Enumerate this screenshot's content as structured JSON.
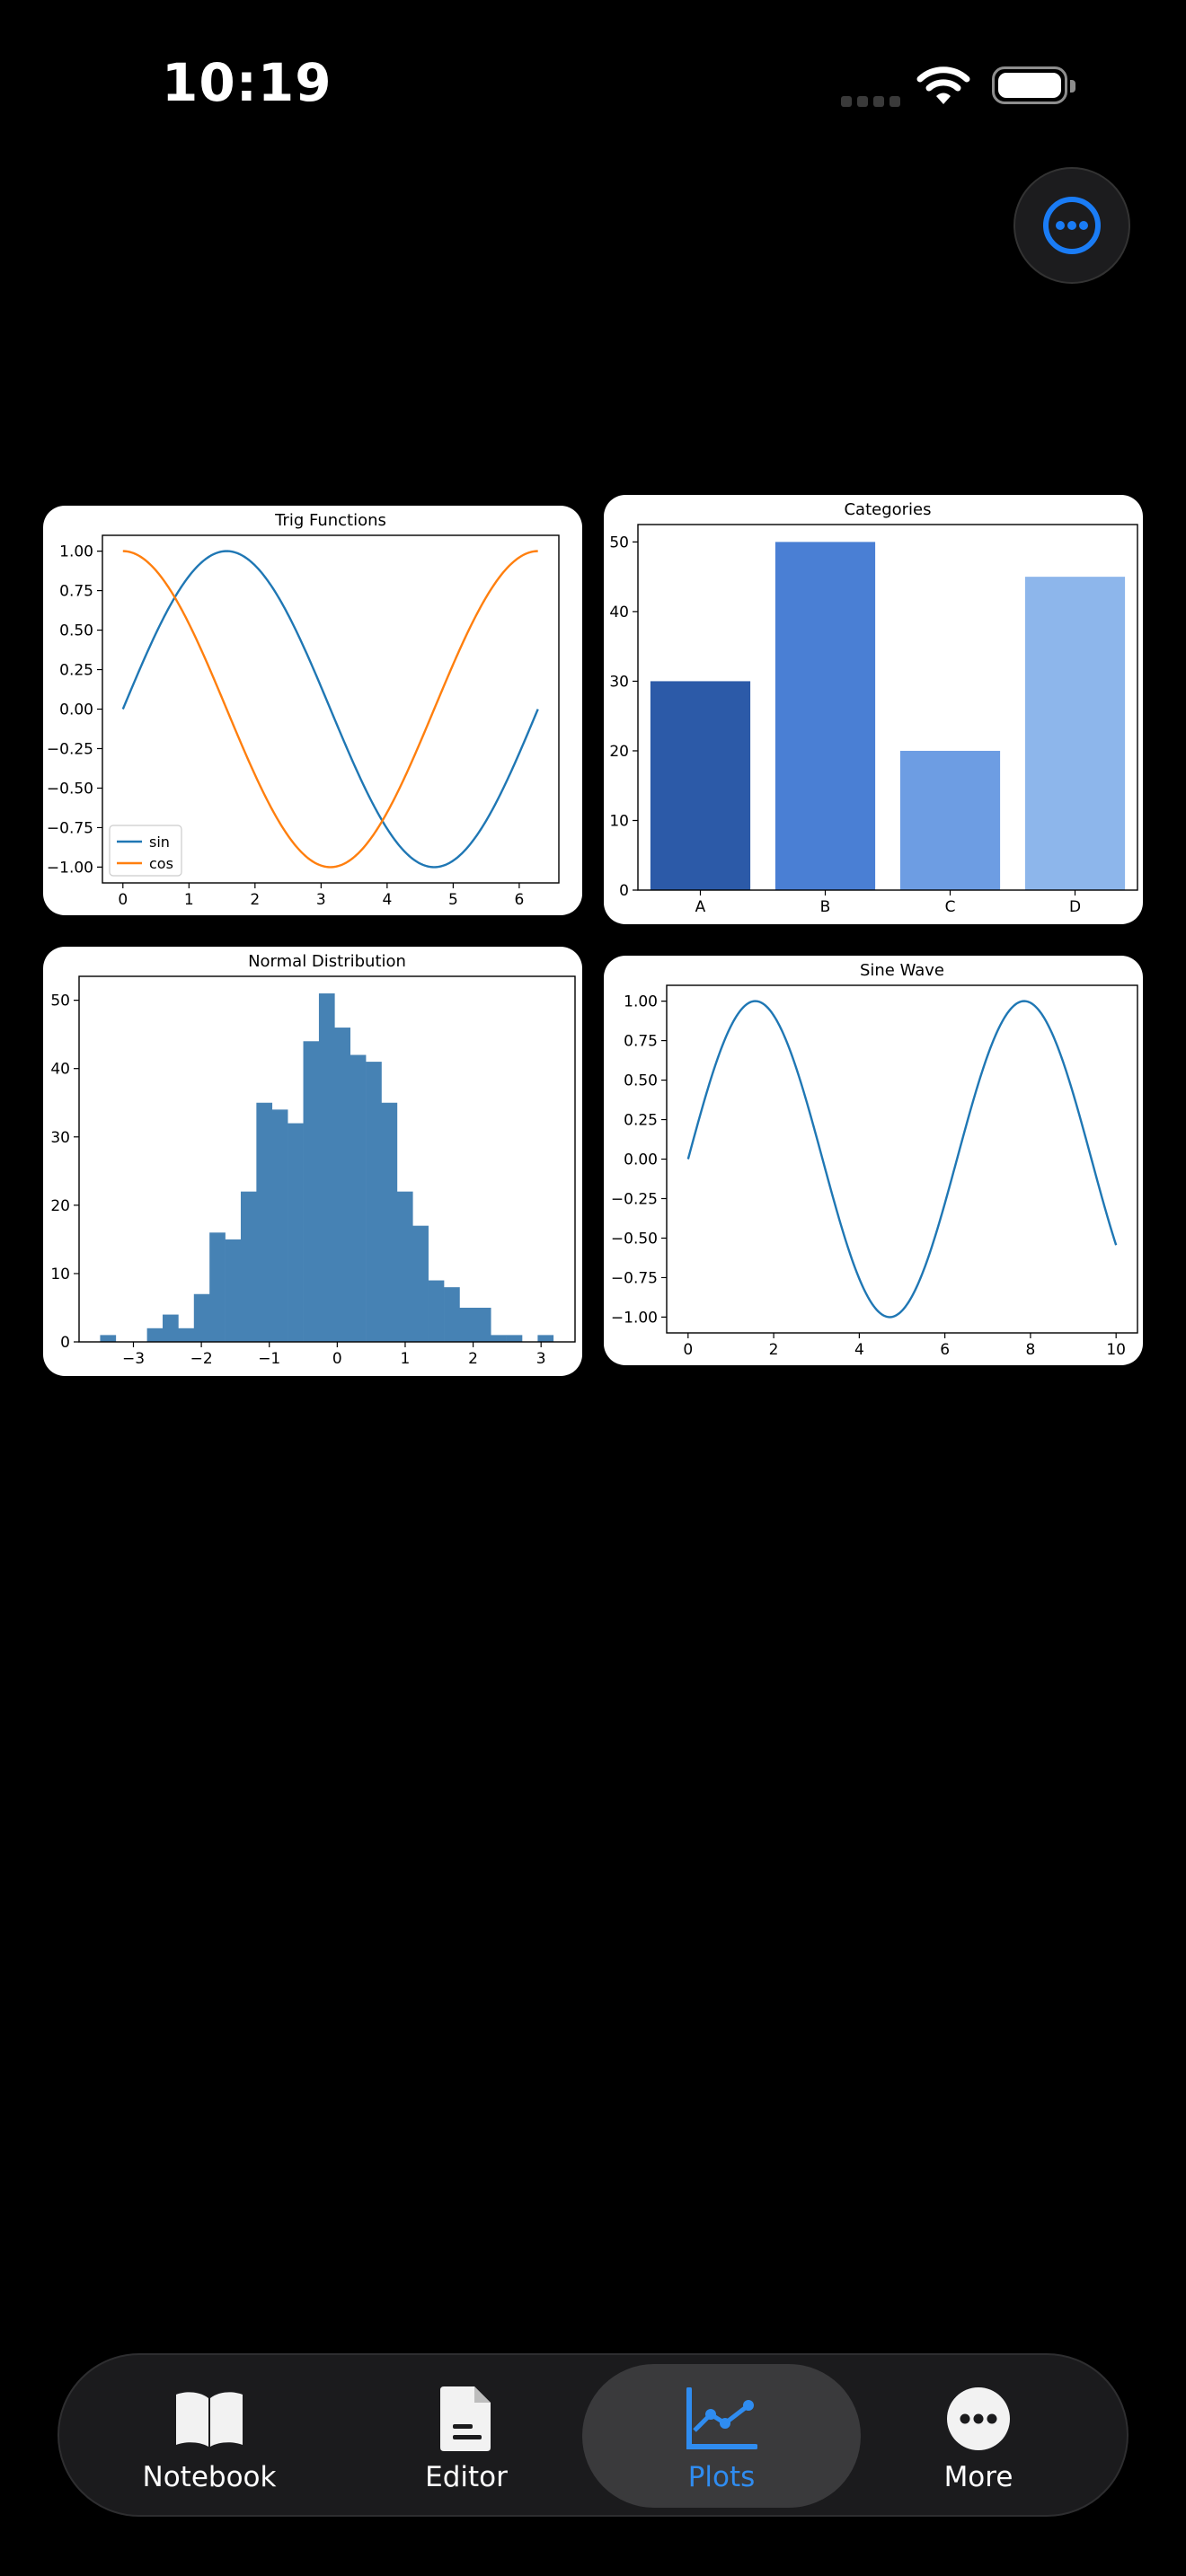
{
  "status": {
    "time": "10:19"
  },
  "charts": [
    {
      "type": "line",
      "title": "Trig Functions",
      "xlim": [
        -0.31,
        6.6
      ],
      "ylim": [
        -1.1,
        1.1
      ],
      "xticks": [
        0,
        1,
        2,
        3,
        4,
        5,
        6
      ],
      "yticks": [
        -1.0,
        -0.75,
        -0.5,
        -0.25,
        0.0,
        0.25,
        0.5,
        0.75,
        1.0
      ],
      "ytick_labels": [
        "−1.00",
        "−0.75",
        "−0.50",
        "−0.25",
        "0.00",
        "0.25",
        "0.50",
        "0.75",
        "1.00"
      ],
      "legend": {
        "position": "lower-left",
        "entries": [
          "sin",
          "cos"
        ]
      },
      "series": [
        {
          "name": "sin",
          "color": "#1f77b4",
          "function": "sin",
          "x_range": [
            0,
            6.283
          ]
        },
        {
          "name": "cos",
          "color": "#ff7f0e",
          "function": "cos",
          "x_range": [
            0,
            6.283
          ]
        }
      ]
    },
    {
      "type": "bar",
      "title": "Categories",
      "categories": [
        "A",
        "B",
        "C",
        "D"
      ],
      "values": [
        30,
        50,
        20,
        45
      ],
      "colors": [
        "#2c5aa8",
        "#4a7fd4",
        "#6d9de3",
        "#8db6eb"
      ],
      "ylim": [
        0,
        52.5
      ],
      "yticks": [
        0,
        10,
        20,
        30,
        40,
        50
      ]
    },
    {
      "type": "bar",
      "title": "Normal Distribution",
      "color": "#4682b4",
      "bin_edges": [
        -3.49,
        -3.26,
        -3.03,
        -2.8,
        -2.57,
        -2.34,
        -2.11,
        -1.88,
        -1.65,
        -1.42,
        -1.19,
        -0.96,
        -0.73,
        -0.5,
        -0.27,
        -0.04,
        0.19,
        0.42,
        0.65,
        0.88,
        1.11,
        1.34,
        1.57,
        1.8,
        2.03,
        2.26,
        2.49,
        2.72,
        2.95,
        3.18
      ],
      "values": [
        1,
        0,
        0,
        2,
        4,
        2,
        7,
        16,
        15,
        22,
        35,
        34,
        32,
        44,
        51,
        46,
        42,
        41,
        35,
        22,
        17,
        9,
        8,
        5,
        5,
        1,
        1,
        0,
        1
      ],
      "xlim": [
        -3.8,
        3.5
      ],
      "ylim": [
        0,
        53.5
      ],
      "xticks": [
        -3,
        -2,
        -1,
        0,
        1,
        2,
        3
      ],
      "xtick_labels": [
        "−3",
        "−2",
        "−1",
        "0",
        "1",
        "2",
        "3"
      ],
      "yticks": [
        0,
        10,
        20,
        30,
        40,
        50
      ]
    },
    {
      "type": "line",
      "title": "Sine Wave",
      "xlim": [
        -0.5,
        10.5
      ],
      "ylim": [
        -1.1,
        1.1
      ],
      "xticks": [
        0,
        2,
        4,
        6,
        8,
        10
      ],
      "yticks": [
        -1.0,
        -0.75,
        -0.5,
        -0.25,
        0.0,
        0.25,
        0.5,
        0.75,
        1.0
      ],
      "ytick_labels": [
        "−1.00",
        "−0.75",
        "−0.50",
        "−0.25",
        "0.00",
        "0.25",
        "0.50",
        "0.75",
        "1.00"
      ],
      "series": [
        {
          "color": "#1f77b4",
          "function": "sin",
          "x_range": [
            0,
            10
          ]
        }
      ]
    }
  ],
  "tabbar": {
    "items": [
      {
        "label": "Notebook",
        "icon": "book-icon"
      },
      {
        "label": "Editor",
        "icon": "document-icon"
      },
      {
        "label": "Plots",
        "icon": "chart-icon",
        "active": true
      },
      {
        "label": "More",
        "icon": "ellipsis-circle-icon"
      }
    ],
    "accent": "#2f8cf0"
  },
  "fab": {
    "icon": "ellipsis-circle-icon",
    "color": "#1a7cf5"
  }
}
